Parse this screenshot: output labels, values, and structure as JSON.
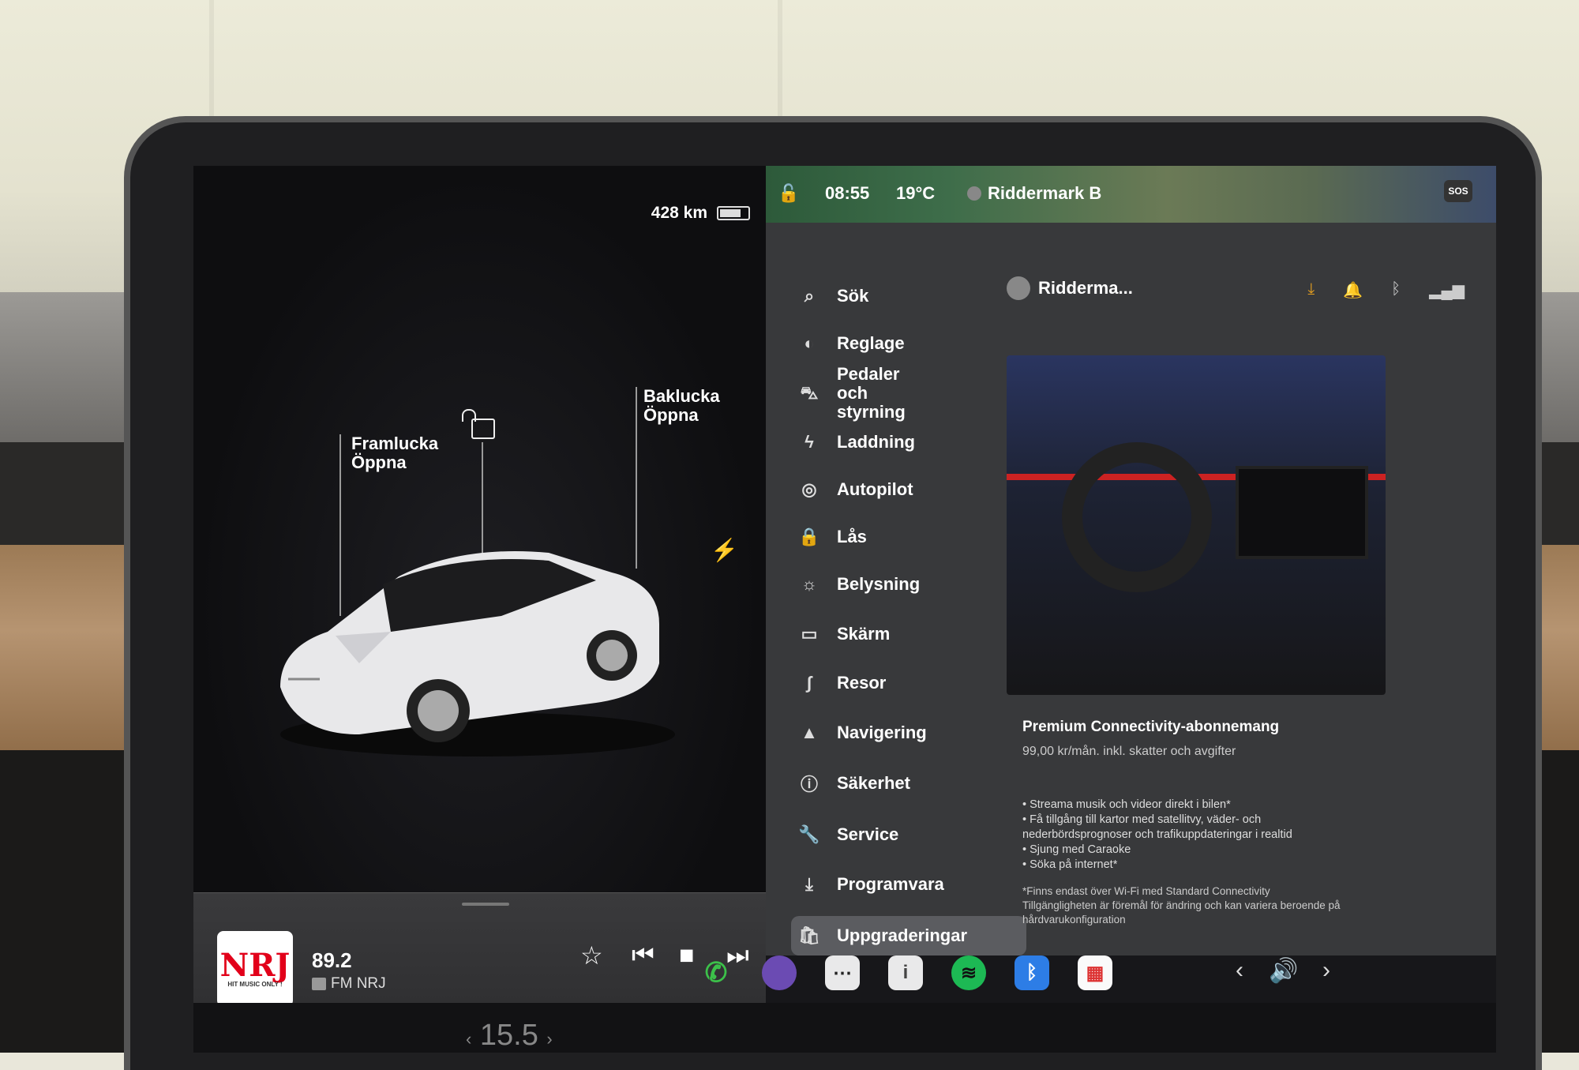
{
  "left_panel": {
    "range": "428 km",
    "frunk_label": "Framlucka",
    "frunk_action": "Öppna",
    "trunk_label": "Baklucka",
    "trunk_action": "Öppna"
  },
  "media": {
    "station_logo": "NRJ",
    "station_slogan": "HIT MUSIC ONLY !",
    "frequency": "89.2",
    "station": "FM NRJ"
  },
  "climate": {
    "temp": "15.5",
    "prev": "‹",
    "next": "›"
  },
  "statusbar": {
    "time": "08:55",
    "outside_temp": "19°C",
    "user": "Riddermark B",
    "sos": "SOS"
  },
  "menu": {
    "items": [
      {
        "label": "Sök",
        "icon": "search-icon"
      },
      {
        "label": "Reglage",
        "icon": "toggle-icon"
      },
      {
        "label": "Pedaler och styrning",
        "icon": "car-icon"
      },
      {
        "label": "Laddning",
        "icon": "bolt-icon"
      },
      {
        "label": "Autopilot",
        "icon": "steering-wheel-icon"
      },
      {
        "label": "Lås",
        "icon": "lock-icon"
      },
      {
        "label": "Belysning",
        "icon": "sun-icon"
      },
      {
        "label": "Skärm",
        "icon": "display-icon"
      },
      {
        "label": "Resor",
        "icon": "trips-icon"
      },
      {
        "label": "Navigering",
        "icon": "navigation-icon"
      },
      {
        "label": "Säkerhet",
        "icon": "alert-icon"
      },
      {
        "label": "Service",
        "icon": "wrench-icon"
      },
      {
        "label": "Programvara",
        "icon": "download-icon"
      },
      {
        "label": "Uppgraderingar",
        "icon": "bag-icon"
      }
    ]
  },
  "profile": {
    "name": "Ridderma..."
  },
  "promo": {
    "title": "Premium Connectivity-abonnemang",
    "price": "99,00 kr/mån. inkl. skatter och avgifter",
    "bullets": [
      "• Streama musik och videor direkt i bilen*",
      "• Få tillgång till kartor med satellitvy, väder- och",
      "nederbördsprognoser och trafikuppdateringar i realtid",
      "• Sjung med Caraoke",
      "• Söka på internet*"
    ],
    "footnote": [
      "*Finns endast över Wi-Fi med Standard Connectivity",
      "Tillgängligheten är föremål för ändring och kan variera beroende på",
      "hårdvarukonfiguration"
    ]
  },
  "volume": {
    "prev": "‹",
    "next": "›"
  },
  "colors": {
    "accent": "#3e6ae1",
    "download": "#e6a020"
  }
}
